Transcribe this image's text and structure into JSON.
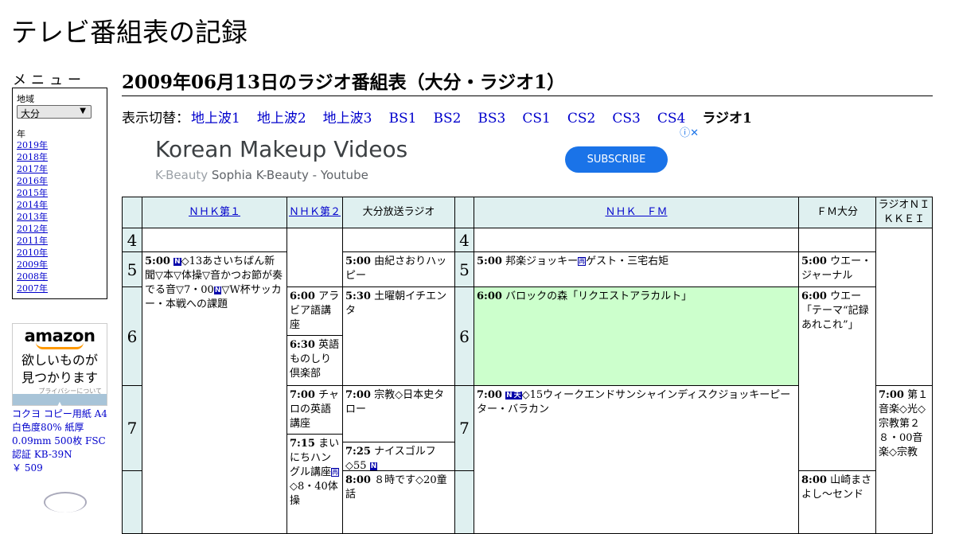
{
  "site_title": "テレビ番組表の記録",
  "sidebar": {
    "menu_title": "メニュー",
    "region_label": "地域",
    "region_value": "大分",
    "year_label": "年",
    "years": [
      "2019年",
      "2018年",
      "2017年",
      "2016年",
      "2015年",
      "2014年",
      "2013年",
      "2012年",
      "2011年",
      "2010年",
      "2009年",
      "2008年",
      "2007年"
    ],
    "amazon_ad": {
      "logo": "amazon",
      "tagline_1": "欲しいものが",
      "tagline_2": "見つかります",
      "privacy": "プライバシーについて"
    },
    "product": {
      "name": "コクヨ コピー用紙 A4 白色度80% 紙厚 0.09mm 500枚 FSC認証 KB-39N",
      "price": "￥ 509"
    }
  },
  "main": {
    "heading": "2009年06月13日のラジオ番組表（大分・ラジオ1）",
    "switch_label": "表示切替：",
    "switch_links": [
      "地上波1",
      "地上波2",
      "地上波3",
      "BS1",
      "BS2",
      "BS3",
      "CS1",
      "CS2",
      "CS3",
      "CS4"
    ],
    "switch_current": "ラジオ1",
    "ad": {
      "headline": "Korean Makeup Videos",
      "sub_a": "K-Beauty",
      "sub_b": "Sophia K-Beauty - Youtube",
      "button": "SUBSCRIBE"
    }
  },
  "schedule": {
    "channels": [
      "ＮＨＫ第１",
      "ＮＨＫ第２",
      "大分放送ラジオ",
      "ＮＨＫ　ＦＭ",
      "ＦＭ大分",
      "ラジオＮＩＫＫＥＩ"
    ],
    "hours": [
      "4",
      "5",
      "6",
      "7"
    ],
    "programs": {
      "nhk1_500_time": "5:00",
      "nhk1_500_badge": "N",
      "nhk1_500_a": "◇13あさいちばん新聞▽本▽体操▽音かつお節が奏でる音▽7・00",
      "nhk1_500_badge2": "N",
      "nhk1_500_b": "▽W杯サッカー・本戦への課題",
      "nhk2_600_time": "6:00",
      "nhk2_600_title": "アラビア語講座",
      "nhk2_630_time": "6:30",
      "nhk2_630_title": "英語ものしり倶楽部",
      "nhk2_700_time": "7:00",
      "nhk2_700_title": "チャロの英語講座",
      "nhk2_715_time": "7:15",
      "nhk2_715_title": "まいにちハングル講座",
      "nhk2_715_badge": "再",
      "nhk2_715_tail": "◇8・40体操",
      "obs_500_time": "5:00",
      "obs_500_title": "由紀さおりハッピー",
      "obs_530_time": "5:30",
      "obs_530_title": "土曜朝イチエンタ",
      "obs_700_time": "7:00",
      "obs_700_title": "宗教◇日本史タロー",
      "obs_725_time": "7:25",
      "obs_725_title": "ナイスゴルフ◇55",
      "obs_725_badge": "N",
      "obs_800_time": "8:00",
      "obs_800_title": "８時です◇20童話",
      "fm_500_time": "5:00",
      "fm_500_title": "邦楽ジョッキー",
      "fm_500_badge": "再",
      "fm_500_tail": "ゲスト・三宅右矩",
      "fm_600_time": "6:00",
      "fm_600_title": "バロックの森「リクエストアラカルト」",
      "fm_700_time": "7:00",
      "fm_700_badge1": "N",
      "fm_700_badge2": "天",
      "fm_700_title": "◇15ウィークエンドサンシャインディスクジョッキーピーター・バラカン",
      "fmo_500_time": "5:00",
      "fmo_500_title": "ウエー・ジャーナル",
      "fmo_600_time": "6:00",
      "fmo_600_title": "ウエー「テーマ“記録あれこれ”」",
      "fmo_800_time": "8:00",
      "fmo_800_title": "山崎まさよし～センド",
      "nikkei_700_time": "7:00",
      "nikkei_700_title": "第１音楽◇光◇宗教第２８・00音楽◇宗教"
    }
  }
}
